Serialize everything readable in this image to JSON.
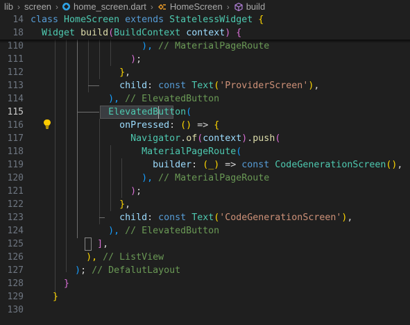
{
  "breadcrumb": {
    "folder1": "lib",
    "folder2": "screen",
    "file": "home_screen.dart",
    "class": "HomeScreen",
    "method": "build",
    "colors": {
      "dart": "#2fa4e7",
      "class": "#ee9d28",
      "method": "#b180d7"
    }
  },
  "editor": {
    "active_line": 115,
    "lines": [
      {
        "n": "14",
        "tokens": [
          [
            "kw",
            "class "
          ],
          [
            "ty",
            "HomeScreen "
          ],
          [
            "kw",
            "extends "
          ],
          [
            "ty",
            "StatelessWidget "
          ],
          [
            "b1",
            "{"
          ]
        ]
      },
      {
        "n": "18",
        "tokens": [
          [
            "pu",
            "  "
          ],
          [
            "ty",
            "Widget "
          ],
          [
            "fn",
            "build"
          ],
          [
            "b2",
            "("
          ],
          [
            "ty",
            "BuildContext "
          ],
          [
            "va",
            "context"
          ],
          [
            "b2",
            ")"
          ],
          [
            "pu",
            " "
          ],
          [
            "b2",
            "{"
          ]
        ]
      },
      {
        "n": "110",
        "tokens": [
          [
            "pu",
            "                    "
          ],
          [
            "b3",
            "),"
          ],
          [
            "cm",
            " // MaterialPageRoute"
          ]
        ]
      },
      {
        "n": "111",
        "tokens": [
          [
            "pu",
            "                  "
          ],
          [
            "b2",
            ")"
          ],
          [
            "pu",
            ";"
          ]
        ]
      },
      {
        "n": "112",
        "tokens": [
          [
            "pu",
            "                "
          ],
          [
            "b1",
            "}"
          ],
          [
            "pu",
            ","
          ]
        ]
      },
      {
        "n": "113",
        "tokens": [
          [
            "pu",
            "                "
          ],
          [
            "va",
            "child"
          ],
          [
            "pu",
            ": "
          ],
          [
            "kw",
            "const "
          ],
          [
            "ty",
            "Text"
          ],
          [
            "b1",
            "("
          ],
          [
            "st",
            "'ProviderScreen'"
          ],
          [
            "b1",
            ")"
          ],
          [
            "pu",
            ","
          ]
        ]
      },
      {
        "n": "114",
        "tokens": [
          [
            "pu",
            "              "
          ],
          [
            "b3",
            "),"
          ],
          [
            "cm",
            " // ElevatedButton"
          ]
        ]
      },
      {
        "n": "115",
        "tokens": [
          [
            "pu",
            "              "
          ],
          [
            "ty",
            "ElevatedButton"
          ],
          [
            "b3",
            "("
          ]
        ]
      },
      {
        "n": "116",
        "tokens": [
          [
            "pu",
            "                "
          ],
          [
            "va",
            "onPressed"
          ],
          [
            "pu",
            ": "
          ],
          [
            "b1",
            "()"
          ],
          [
            "pu",
            " => "
          ],
          [
            "b1",
            "{"
          ]
        ]
      },
      {
        "n": "117",
        "tokens": [
          [
            "pu",
            "                  "
          ],
          [
            "ty",
            "Navigator"
          ],
          [
            "pu",
            "."
          ],
          [
            "fn",
            "of"
          ],
          [
            "b2",
            "("
          ],
          [
            "va",
            "context"
          ],
          [
            "b2",
            ")"
          ],
          [
            "pu",
            "."
          ],
          [
            "fn",
            "push"
          ],
          [
            "b2",
            "("
          ]
        ]
      },
      {
        "n": "118",
        "tokens": [
          [
            "pu",
            "                    "
          ],
          [
            "ty",
            "MaterialPageRoute"
          ],
          [
            "b3",
            "("
          ]
        ]
      },
      {
        "n": "119",
        "tokens": [
          [
            "pu",
            "                      "
          ],
          [
            "va",
            "builder"
          ],
          [
            "pu",
            ": "
          ],
          [
            "b1",
            "(_)"
          ],
          [
            "pu",
            " => "
          ],
          [
            "kw",
            "const "
          ],
          [
            "ty",
            "CodeGenerationScreen"
          ],
          [
            "b1",
            "()"
          ],
          [
            "pu",
            ","
          ]
        ]
      },
      {
        "n": "120",
        "tokens": [
          [
            "pu",
            "                    "
          ],
          [
            "b3",
            "),"
          ],
          [
            "cm",
            " // MaterialPageRoute"
          ]
        ]
      },
      {
        "n": "121",
        "tokens": [
          [
            "pu",
            "                  "
          ],
          [
            "b2",
            ")"
          ],
          [
            "pu",
            ";"
          ]
        ]
      },
      {
        "n": "122",
        "tokens": [
          [
            "pu",
            "                "
          ],
          [
            "b1",
            "}"
          ],
          [
            "pu",
            ","
          ]
        ]
      },
      {
        "n": "123",
        "tokens": [
          [
            "pu",
            "                "
          ],
          [
            "va",
            "child"
          ],
          [
            "pu",
            ": "
          ],
          [
            "kw",
            "const "
          ],
          [
            "ty",
            "Text"
          ],
          [
            "b1",
            "("
          ],
          [
            "st",
            "'CodeGenerationScreen'"
          ],
          [
            "b1",
            ")"
          ],
          [
            "pu",
            ","
          ]
        ]
      },
      {
        "n": "124",
        "tokens": [
          [
            "pu",
            "              "
          ],
          [
            "b3",
            "),"
          ],
          [
            "cm",
            " // ElevatedButton"
          ]
        ]
      },
      {
        "n": "125",
        "tokens": [
          [
            "pu",
            "            "
          ],
          [
            "b2",
            "]"
          ],
          [
            "pu",
            ","
          ]
        ]
      },
      {
        "n": "126",
        "tokens": [
          [
            "pu",
            "          "
          ],
          [
            "b1",
            "),"
          ],
          [
            "cm",
            " // ListView"
          ]
        ]
      },
      {
        "n": "127",
        "tokens": [
          [
            "pu",
            "        "
          ],
          [
            "b3",
            ")"
          ],
          [
            "pu",
            ";"
          ],
          [
            "cm",
            " // DefalutLayout"
          ]
        ]
      },
      {
        "n": "128",
        "tokens": [
          [
            "pu",
            "      "
          ],
          [
            "b2",
            "}"
          ]
        ]
      },
      {
        "n": "129",
        "tokens": [
          [
            "pu",
            "    "
          ],
          [
            "b1",
            "}"
          ]
        ]
      },
      {
        "n": "130",
        "tokens": []
      }
    ]
  }
}
